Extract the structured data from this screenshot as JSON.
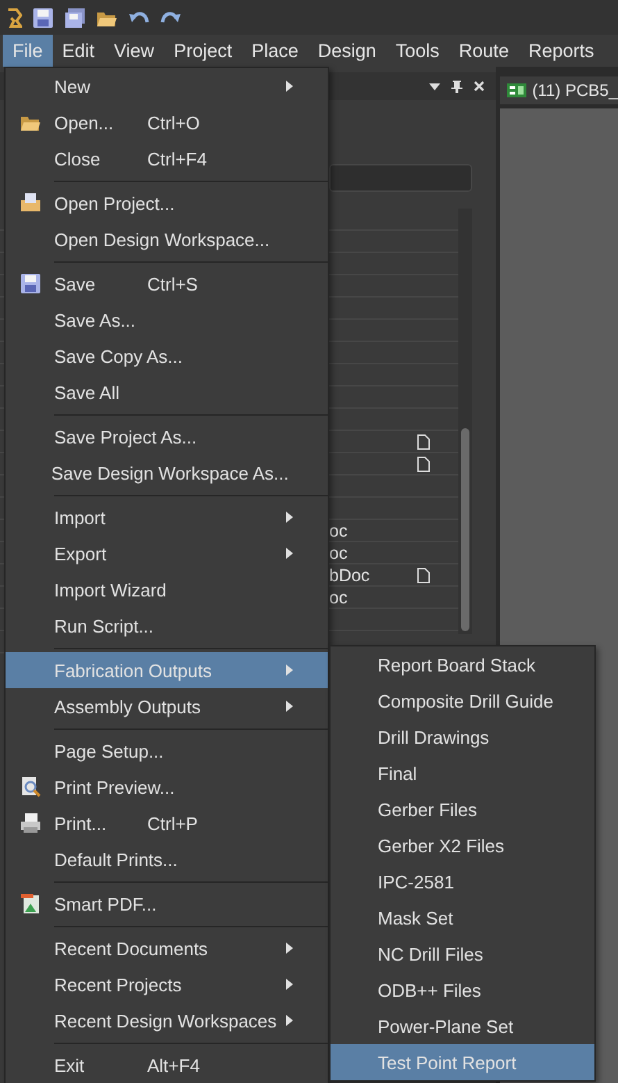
{
  "menubar": [
    {
      "label": "File",
      "selected": true
    },
    {
      "label": "Edit",
      "selected": false
    },
    {
      "label": "View",
      "selected": false
    },
    {
      "label": "Project",
      "selected": false
    },
    {
      "label": "Place",
      "selected": false
    },
    {
      "label": "Design",
      "selected": false
    },
    {
      "label": "Tools",
      "selected": false
    },
    {
      "label": "Route",
      "selected": false
    },
    {
      "label": "Reports",
      "selected": false
    }
  ],
  "panel": {
    "rows": [
      {
        "kind": "plain"
      },
      {
        "kind": "plain"
      },
      {
        "kind": "plain"
      },
      {
        "kind": "plain"
      },
      {
        "kind": "plain"
      },
      {
        "kind": "plain"
      },
      {
        "kind": "plain"
      },
      {
        "kind": "plain"
      },
      {
        "kind": "plain"
      },
      {
        "kind": "plain"
      },
      {
        "kind": "file"
      },
      {
        "kind": "file"
      },
      {
        "kind": "plain"
      },
      {
        "kind": "plain"
      },
      {
        "kind": "text",
        "text": "oc"
      },
      {
        "kind": "text",
        "text": "oc"
      },
      {
        "kind": "textfile",
        "text": "bDoc"
      },
      {
        "kind": "text",
        "text": "oc"
      },
      {
        "kind": "plain"
      },
      {
        "kind": "plain"
      }
    ]
  },
  "document_tab": {
    "label": "(11) PCB5_"
  },
  "file_menu": {
    "items": [
      {
        "kind": "item",
        "label": "New",
        "submenu": true,
        "selected": false
      },
      {
        "kind": "folder",
        "label": "Open...",
        "shortcut": "Ctrl+O",
        "selected": false
      },
      {
        "kind": "item",
        "label": "Close",
        "shortcut": "Ctrl+F4",
        "selected": false
      },
      {
        "kind": "separator"
      },
      {
        "kind": "project",
        "label": "Open Project...",
        "selected": false
      },
      {
        "kind": "item",
        "label": "Open Design Workspace...",
        "selected": false
      },
      {
        "kind": "separator"
      },
      {
        "kind": "save",
        "label": "Save",
        "shortcut": "Ctrl+S",
        "selected": false
      },
      {
        "kind": "item",
        "label": "Save As...",
        "selected": false
      },
      {
        "kind": "item",
        "label": "Save Copy As...",
        "selected": false
      },
      {
        "kind": "item",
        "label": "Save All",
        "selected": false
      },
      {
        "kind": "separator"
      },
      {
        "kind": "item",
        "label": "Save Project As...",
        "selected": false
      },
      {
        "kind": "item",
        "label": "Save Design Workspace As...",
        "selected": false
      },
      {
        "kind": "separator"
      },
      {
        "kind": "item",
        "label": "Import",
        "submenu": true,
        "selected": false
      },
      {
        "kind": "item",
        "label": "Export",
        "submenu": true,
        "selected": false
      },
      {
        "kind": "item",
        "label": "Import Wizard",
        "selected": false
      },
      {
        "kind": "item",
        "label": "Run Script...",
        "selected": false
      },
      {
        "kind": "separator"
      },
      {
        "kind": "item",
        "label": "Fabrication Outputs",
        "submenu": true,
        "selected": true
      },
      {
        "kind": "item",
        "label": "Assembly Outputs",
        "submenu": true,
        "selected": false
      },
      {
        "kind": "separator"
      },
      {
        "kind": "item",
        "label": "Page Setup...",
        "selected": false
      },
      {
        "kind": "preview",
        "label": "Print Preview...",
        "selected": false
      },
      {
        "kind": "print",
        "label": "Print...",
        "shortcut": "Ctrl+P",
        "selected": false
      },
      {
        "kind": "item",
        "label": "Default Prints...",
        "selected": false
      },
      {
        "kind": "separator"
      },
      {
        "kind": "pdf",
        "label": "Smart PDF...",
        "selected": false
      },
      {
        "kind": "separator"
      },
      {
        "kind": "item",
        "label": "Recent Documents",
        "submenu": true,
        "selected": false
      },
      {
        "kind": "item",
        "label": "Recent Projects",
        "submenu": true,
        "selected": false
      },
      {
        "kind": "item",
        "label": "Recent Design Workspaces",
        "submenu": true,
        "selected": false
      },
      {
        "kind": "separator"
      },
      {
        "kind": "item",
        "label": "Exit",
        "shortcut": "Alt+F4",
        "selected": false
      }
    ]
  },
  "fabrication_submenu": {
    "items": [
      {
        "label": "Report Board Stack",
        "selected": false
      },
      {
        "label": "Composite Drill Guide",
        "selected": false
      },
      {
        "label": "Drill Drawings",
        "selected": false
      },
      {
        "label": "Final",
        "selected": false
      },
      {
        "label": "Gerber Files",
        "selected": false
      },
      {
        "label": "Gerber X2 Files",
        "selected": false
      },
      {
        "label": "IPC-2581",
        "selected": false
      },
      {
        "label": "Mask Set",
        "selected": false
      },
      {
        "label": "NC Drill Files",
        "selected": false
      },
      {
        "label": "ODB++ Files",
        "selected": false
      },
      {
        "label": "Power-Plane Set",
        "selected": false
      },
      {
        "label": "Test Point Report",
        "selected": true
      }
    ]
  }
}
